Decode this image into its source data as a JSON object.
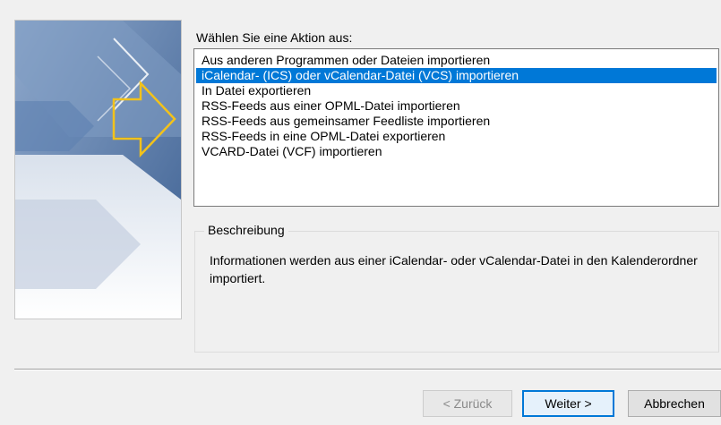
{
  "prompt": "Wählen Sie eine Aktion aus:",
  "actions": [
    "Aus anderen Programmen oder Dateien importieren",
    "iCalendar- (ICS) oder vCalendar-Datei (VCS) importieren",
    "In Datei exportieren",
    "RSS-Feeds aus einer OPML-Datei importieren",
    "RSS-Feeds aus gemeinsamer Feedliste importieren",
    "RSS-Feeds in eine OPML-Datei exportieren",
    "VCARD-Datei (VCF) importieren"
  ],
  "selected_action_index": 1,
  "description": {
    "legend": "Beschreibung",
    "text": "Informationen werden aus einer iCalendar- oder vCalendar-Datei in den Kalenderordner importiert."
  },
  "buttons": {
    "back": "< Zurück",
    "next": "Weiter >",
    "cancel": "Abbrechen"
  },
  "colors": {
    "selection": "#0078d7",
    "dialog_background": "#f0f0f0",
    "banner_arrow": "#f2c21b"
  },
  "icons": {
    "banner": "wizard-arrows-graphic"
  }
}
